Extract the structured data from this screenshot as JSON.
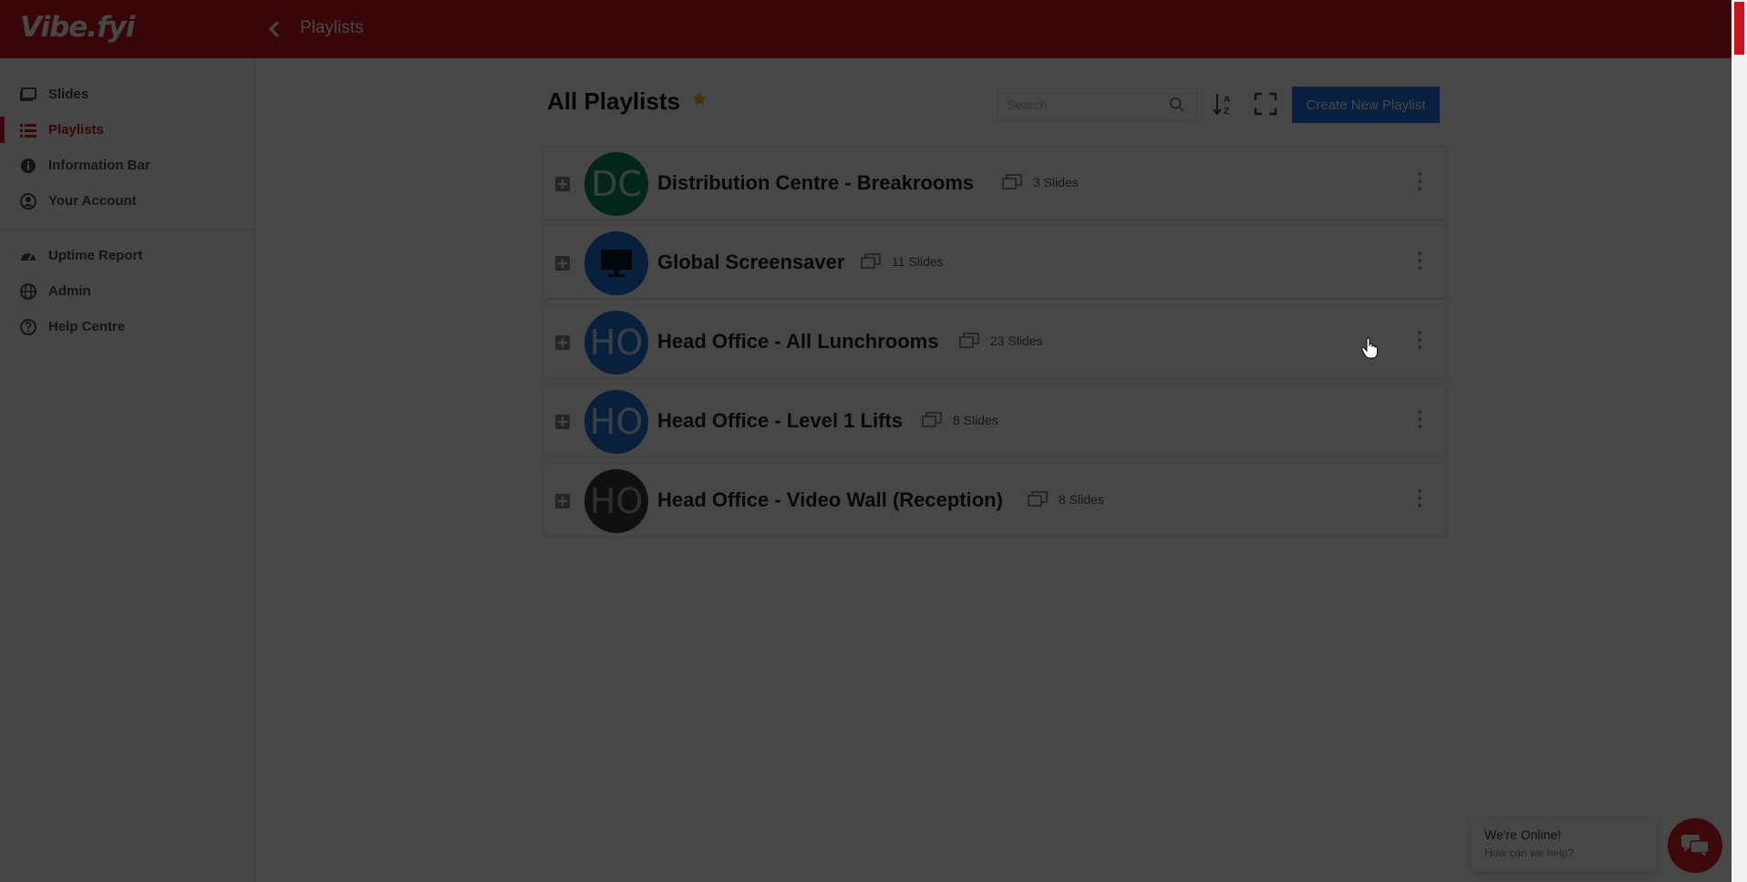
{
  "app": {
    "logo_text": "Vibe.fyi",
    "brand_color": "#c8141e"
  },
  "header": {
    "title": "Playlists",
    "back_icon": "chevron-left-icon"
  },
  "sidebar": {
    "items": [
      {
        "label": "Slides",
        "icon": "slides-icon",
        "active": false
      },
      {
        "label": "Playlists",
        "icon": "list-icon",
        "active": true
      },
      {
        "label": "Information Bar",
        "icon": "info-icon",
        "active": false
      },
      {
        "label": "Your Account",
        "icon": "account-icon",
        "active": false
      }
    ],
    "items2": [
      {
        "label": "Uptime Report",
        "icon": "gauge-icon"
      },
      {
        "label": "Admin",
        "icon": "globe-icon"
      },
      {
        "label": "Help Centre",
        "icon": "question-icon"
      }
    ]
  },
  "main": {
    "title": "All Playlists",
    "search_placeholder": "Search",
    "search_value": "",
    "create_button": "Create New Playlist"
  },
  "playlists": [
    {
      "initials": "DC",
      "name": "Distribution Centre - Breakrooms",
      "slides": "3 Slides",
      "avatar_color": "#0d8a5f"
    },
    {
      "initials": "",
      "name": "Global Screensaver",
      "slides": "11 Slides",
      "avatar_color": "#1e73d6",
      "avatar_icon": "monitor-icon"
    },
    {
      "initials": "HO",
      "name": "Head Office - All Lunchrooms",
      "slides": "23 Slides",
      "avatar_color": "#1e73d6"
    },
    {
      "initials": "HO",
      "name": "Head Office - Level 1 Lifts",
      "slides": "8 Slides",
      "avatar_color": "#1e73d6"
    },
    {
      "initials": "HO",
      "name": "Head Office - Video Wall (Reception)",
      "slides": "8 Slides",
      "avatar_color": "#3a3a3a"
    }
  ],
  "chat": {
    "line1": "We're Online!",
    "line2": "How can we help?"
  }
}
